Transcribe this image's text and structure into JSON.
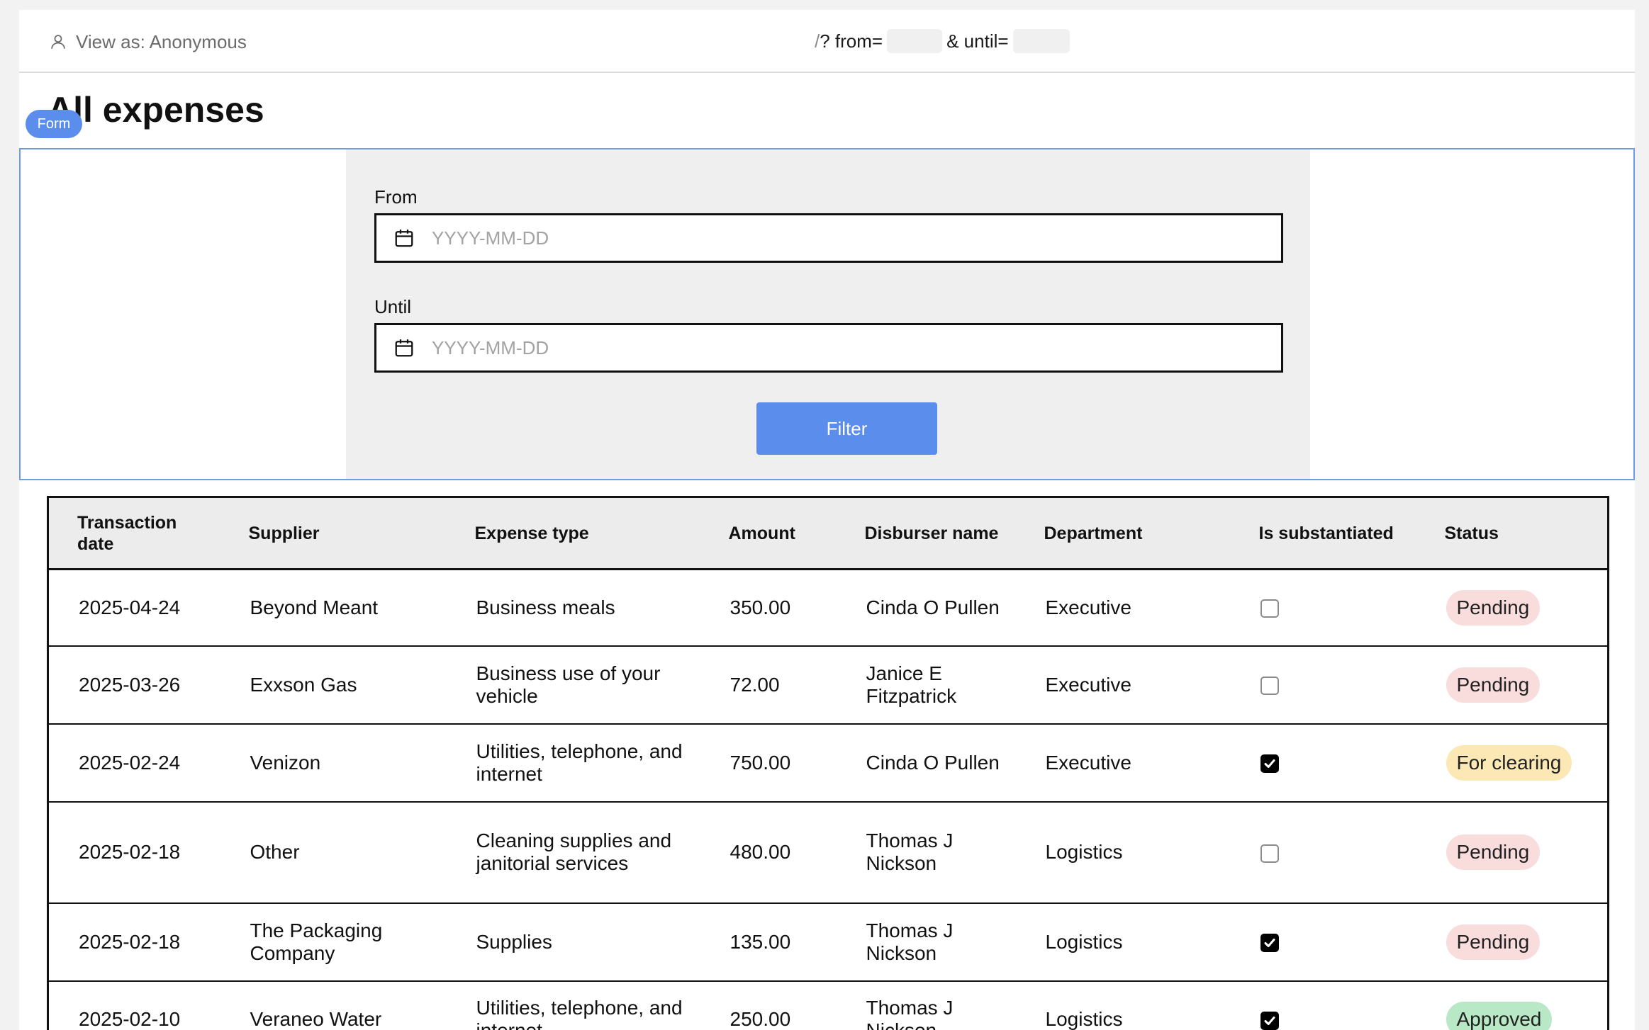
{
  "header": {
    "view_as_label": "View as: Anonymous",
    "url_slash": "/",
    "url_from_label": "? from=",
    "url_until_label": "& until="
  },
  "page": {
    "title": "All expenses",
    "form_badge": "Form"
  },
  "form": {
    "from_label": "From",
    "from_placeholder": "YYYY-MM-DD",
    "from_value": "",
    "until_label": "Until",
    "until_placeholder": "YYYY-MM-DD",
    "until_value": "",
    "filter_button": "Filter"
  },
  "table": {
    "columns": [
      "Transaction date",
      "Supplier",
      "Expense type",
      "Amount",
      "Disburser name",
      "Department",
      "Is substantiated",
      "Status"
    ],
    "rows": [
      {
        "date": "2025-04-24",
        "supplier": "Beyond Meant",
        "expense_type": "Business meals",
        "amount": "350.00",
        "disburser": "Cinda O Pullen",
        "department": "Executive",
        "substantiated": false,
        "status": "Pending"
      },
      {
        "date": "2025-03-26",
        "supplier": "Exxson Gas",
        "expense_type": "Business use of your vehicle",
        "amount": "72.00",
        "disburser": "Janice E Fitzpatrick",
        "department": "Executive",
        "substantiated": false,
        "status": "Pending"
      },
      {
        "date": "2025-02-24",
        "supplier": "Venizon",
        "expense_type": "Utilities, telephone, and internet",
        "amount": "750.00",
        "disburser": "Cinda O Pullen",
        "department": "Executive",
        "substantiated": true,
        "status": "For clearing"
      },
      {
        "date": "2025-02-18",
        "supplier": "Other",
        "expense_type": "Cleaning supplies and janitorial services",
        "amount": "480.00",
        "disburser": "Thomas J Nickson",
        "department": "Logistics",
        "substantiated": false,
        "status": "Pending"
      },
      {
        "date": "2025-02-18",
        "supplier": "The Packaging Company",
        "expense_type": "Supplies",
        "amount": "135.00",
        "disburser": "Thomas J Nickson",
        "department": "Logistics",
        "substantiated": true,
        "status": "Pending"
      },
      {
        "date": "2025-02-10",
        "supplier": "Veraneo Water",
        "expense_type": "Utilities, telephone, and internet",
        "amount": "250.00",
        "disburser": "Thomas J Nickson",
        "department": "Logistics",
        "substantiated": true,
        "status": "Approved"
      }
    ]
  },
  "colors": {
    "accent": "#5b8ded",
    "status_pending": "#f9dcdc",
    "status_for_clearing": "#fbe8b5",
    "status_approved": "#b9e8c6"
  },
  "icons": {
    "user": "user-icon",
    "calendar": "calendar-icon",
    "check": "check-icon"
  }
}
